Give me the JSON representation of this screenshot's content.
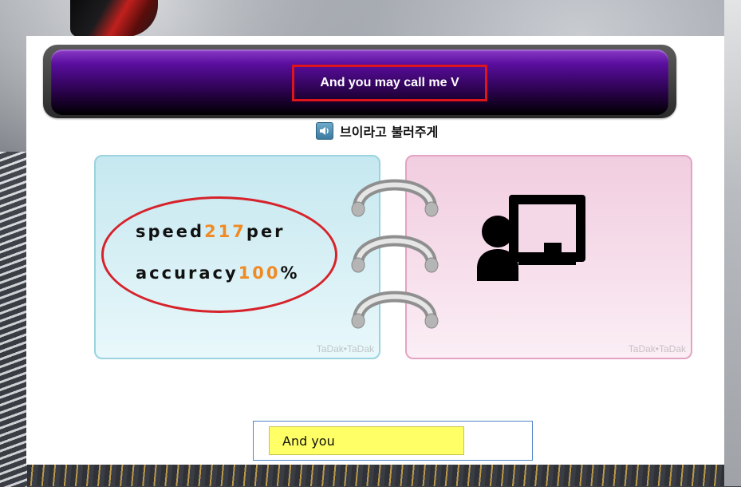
{
  "banner": {
    "sentence": "And you may call me V"
  },
  "translation": {
    "text": "브이라고 불러주게",
    "icon": "speaker-icon"
  },
  "stats": {
    "speed_label": "speed",
    "speed_value": "217",
    "speed_unit": "per",
    "accuracy_label": "accuracy",
    "accuracy_value": "100",
    "accuracy_unit": "%"
  },
  "cards": {
    "left_watermark": "TaDak•TaDak",
    "right_watermark": "TaDak•TaDak"
  },
  "presenter": {
    "icon": "presenter-icon"
  },
  "typing": {
    "value": "And you"
  },
  "colors": {
    "accent_orange": "#f08a24",
    "highlight_red": "#e0141b",
    "input_yellow": "#ffff66"
  }
}
